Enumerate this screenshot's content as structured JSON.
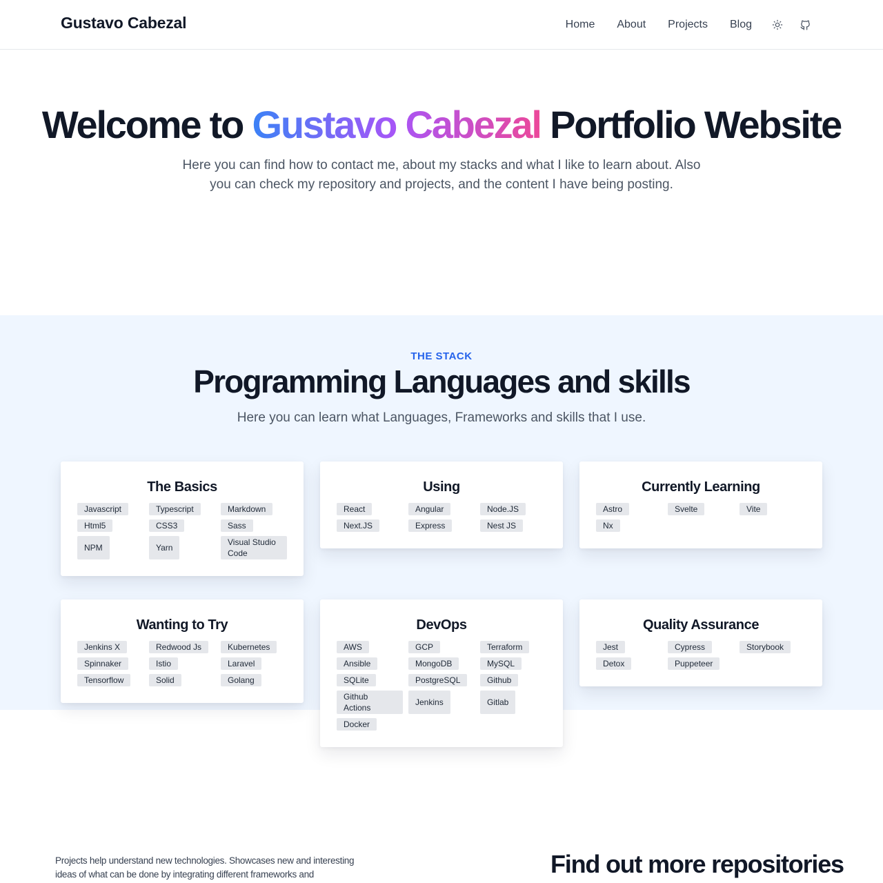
{
  "header": {
    "brand": "Gustavo Cabezal",
    "nav": [
      "Home",
      "About",
      "Projects",
      "Blog"
    ],
    "icons": [
      "sun-icon",
      "github-icon"
    ]
  },
  "hero": {
    "title_before": "Welcome to ",
    "title_highlight": "Gustavo Cabezal",
    "title_after": " Portfolio Website",
    "subtitle": "Here you can find how to contact me, about my stacks and what I like to learn about. Also you can check my repository and projects, and the content I have being posting.",
    "gradient_colors": [
      "#3b82f6",
      "#a855f7",
      "#ec4899"
    ]
  },
  "stack": {
    "eyebrow": "THE STACK",
    "title": "Programming Languages and skills",
    "subtitle": "Here you can learn what Languages, Frameworks and skills that I use.",
    "accent": "#2563eb",
    "background": "#eff6ff",
    "cards": [
      {
        "title": "The Basics",
        "tags": [
          "Javascript",
          "Typescript",
          "Markdown",
          "Html5",
          "CSS3",
          "Sass",
          "NPM",
          "Yarn",
          "Visual Studio Code"
        ]
      },
      {
        "title": "Using",
        "tags": [
          "React",
          "Angular",
          "Node.JS",
          "Next.JS",
          "Express",
          "Nest JS"
        ]
      },
      {
        "title": "Currently Learning",
        "tags": [
          "Astro",
          "Svelte",
          "Vite",
          "Nx"
        ]
      },
      {
        "title": "Wanting to Try",
        "tags": [
          "Jenkins X",
          "Redwood Js",
          "Kubernetes",
          "Spinnaker",
          "Istio",
          "Laravel",
          "Tensorflow",
          "Solid",
          "Golang"
        ]
      },
      {
        "title": "DevOps",
        "tags": [
          "AWS",
          "GCP",
          "Terraform",
          "Ansible",
          "MongoDB",
          "MySQL",
          "SQLite",
          "PostgreSQL",
          "Github",
          "Github Actions",
          "Jenkins",
          "Gitlab",
          "Docker"
        ]
      },
      {
        "title": "Quality Assurance",
        "tags": [
          "Jest",
          "Cypress",
          "Storybook",
          "Detox",
          "Puppeteer"
        ]
      }
    ]
  },
  "projects": {
    "text": "Projects help understand new technologies. Showcases new and interesting ideas of what can be done by integrating different frameworks and",
    "title": "Find out more repositories in my Project Page"
  }
}
